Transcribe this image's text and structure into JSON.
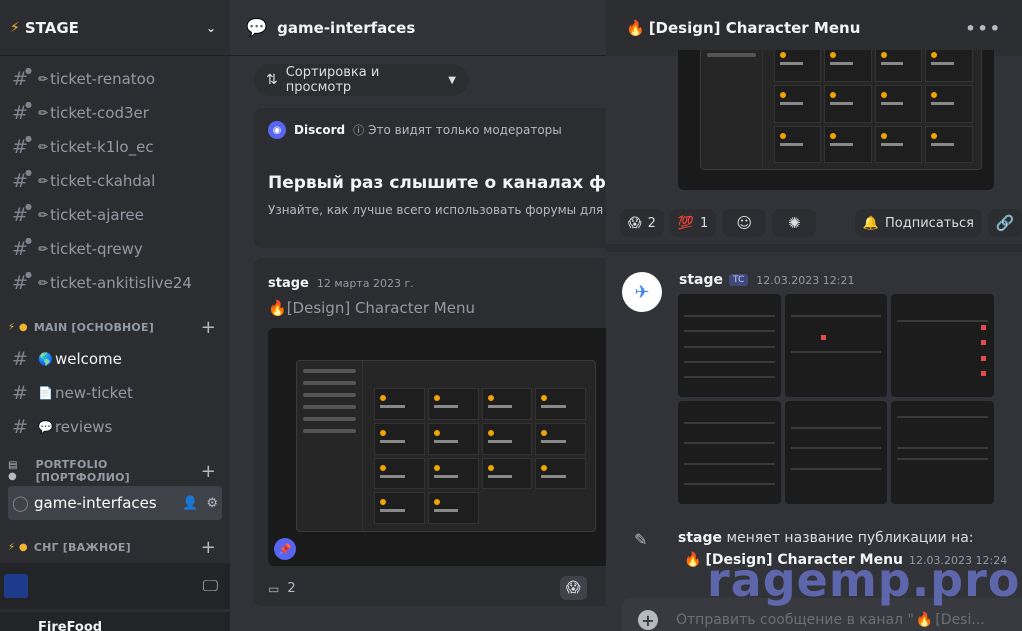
{
  "server": {
    "name": "STAGE"
  },
  "channels_top": [
    {
      "label": "ticket-renatoo"
    },
    {
      "label": "ticket-cod3er"
    },
    {
      "label": "ticket-k1lo_ec"
    },
    {
      "label": "ticket-ckahdal"
    },
    {
      "label": "ticket-ajaree"
    },
    {
      "label": "ticket-qrewy"
    },
    {
      "label": "ticket-ankitislive24"
    }
  ],
  "category_main": {
    "label": "MAIN [ОСНОВНОЕ]"
  },
  "channels_main": [
    {
      "emoji": "🌎",
      "label": "welcome"
    },
    {
      "emoji": "📄",
      "label": "new-ticket"
    },
    {
      "emoji": "💬",
      "label": "reviews"
    }
  ],
  "category_portfolio": {
    "label": "PORTFOLIO [ПОРТФОЛИО]"
  },
  "channel_active": {
    "label": "game-interfaces"
  },
  "category_sng": {
    "label": "СНГ [ВАЖНОЕ]"
  },
  "user": {
    "name": "FireFood"
  },
  "forum": {
    "channel_title": "game-interfaces",
    "sort_label": "Сортировка и просмотр",
    "notice": {
      "source": "Discord",
      "mod_note": "Это видят только модераторы",
      "title": "Первый раз слышите о каналах форумов?",
      "body": "Узнайте, как лучше всего использовать форумы для сообщества."
    },
    "post": {
      "author": "stage",
      "date": "12 марта 2023 г.",
      "title": "[Design] Character Menu",
      "comments": "2"
    }
  },
  "thread": {
    "title": "[Design] Character Menu",
    "reactions": [
      {
        "emoji": "😱",
        "count": "2"
      },
      {
        "emoji": "💯",
        "count": "1"
      }
    ],
    "subscribe_label": "Подписаться",
    "message": {
      "author": "stage",
      "tag": "TC",
      "time": "12.03.2023 12:21"
    },
    "system": {
      "author": "stage",
      "action": "меняет название публикации на:",
      "new_title": "[Design] Character Menu",
      "time": "12.03.2023 12:24"
    },
    "composer_placeholder": "Отправить сообщение в канал \"",
    "composer_tail": "[Desi..."
  },
  "watermark": "ragemp.pro",
  "colors": {
    "brand": "#5865f2",
    "flame": "#f0b232",
    "bg": "#313338",
    "sidebar": "#2b2d31"
  }
}
